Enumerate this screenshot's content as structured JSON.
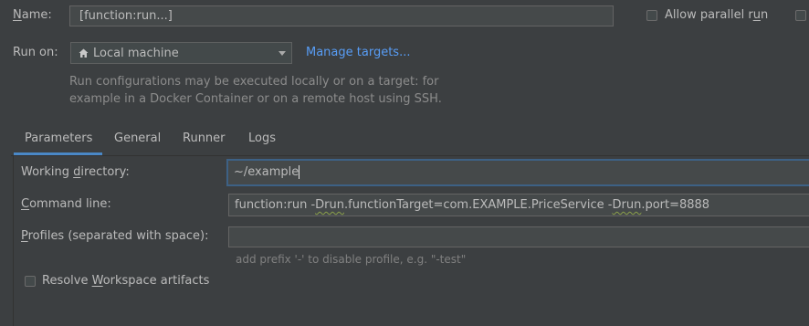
{
  "header": {
    "name_label": "Name:",
    "name_label_mnemonic": "N",
    "name_label_rest": "ame:",
    "name_value": "[function:run...]",
    "allow_parallel_label": "Allow parallel run",
    "allow_parallel_label_main": "Allow parallel r",
    "allow_parallel_label_mnemonic": "u",
    "allow_parallel_label_rest": "n",
    "allow_parallel_checked": false
  },
  "run_on": {
    "label": "Run on:",
    "target": "Local machine",
    "target_icon": "home-icon",
    "manage_link": "Manage targets...",
    "description_line1": "Run configurations may be executed locally or on a target: for",
    "description_line2": "example in a Docker Container or on a remote host using SSH."
  },
  "tabs": [
    {
      "label": "Parameters",
      "selected": true
    },
    {
      "label": "General",
      "selected": false
    },
    {
      "label": "Runner",
      "selected": false
    },
    {
      "label": "Logs",
      "selected": false
    }
  ],
  "parameters": {
    "working_dir": {
      "label": "Working directory:",
      "label_pre": "Working ",
      "label_mnemonic": "d",
      "label_post": "irectory:",
      "value": "~/example"
    },
    "command_line": {
      "label": "Command line:",
      "label_mnemonic": "C",
      "label_post": "ommand line:",
      "value": "function:run -Drun.functionTarget=com.EXAMPLE.PriceService -Drun.port=8888",
      "value_parts": [
        "function:run -",
        "Drun",
        ".functionTarget=com.EXAMPLE.PriceService -",
        "Drun",
        ".port=8888"
      ]
    },
    "profiles": {
      "label": "Profiles (separated with space):",
      "label_mnemonic": "P",
      "label_post": "rofiles (separated with space):",
      "value": "",
      "hint": "add prefix '-' to disable profile, e.g. \"-test\""
    },
    "resolve_workspace": {
      "label": "Resolve Workspace artifacts",
      "label_pre": "Resolve ",
      "label_mnemonic": "W",
      "label_post": "orkspace artifacts",
      "checked": false
    }
  },
  "colors": {
    "background": "#3c3f41",
    "link": "#589df6",
    "tab_underline": "#4a88c7",
    "focus_border": "#3d6185"
  }
}
